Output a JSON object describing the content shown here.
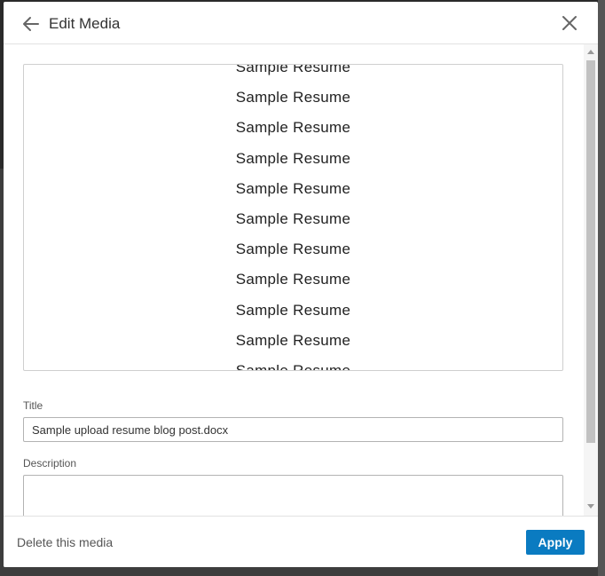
{
  "modal": {
    "title": "Edit Media",
    "back_icon": "arrow-left-icon",
    "close_icon": "close-icon"
  },
  "preview": {
    "lines": [
      "Sample Resume",
      "Sample Resume",
      "Sample Resume",
      "Sample Resume",
      "Sample Resume",
      "Sample Resume",
      "Sample Resume",
      "Sample Resume",
      "Sample Resume",
      "Sample Resume",
      "Sample Resume"
    ]
  },
  "form": {
    "title_label": "Title",
    "title_value": "Sample upload resume blog post.docx",
    "description_label": "Description",
    "description_value": ""
  },
  "footer": {
    "delete_label": "Delete this media",
    "apply_label": "Apply"
  },
  "colors": {
    "accent": "#0a7bc1",
    "text": "#333333"
  }
}
